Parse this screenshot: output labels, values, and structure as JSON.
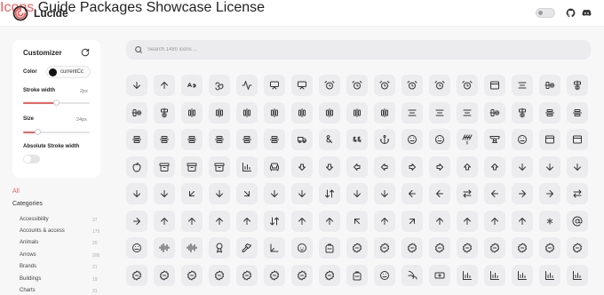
{
  "brand": {
    "name": "Lucide",
    "accent": "#f25f5c"
  },
  "nav": [
    {
      "label": "Icons",
      "active": true
    },
    {
      "label": "Guide",
      "active": false
    },
    {
      "label": "Packages",
      "active": false
    },
    {
      "label": "Showcase",
      "active": false
    },
    {
      "label": "License",
      "active": false
    }
  ],
  "header_icons": [
    "theme-toggle",
    "github-icon",
    "discord-icon"
  ],
  "customizer": {
    "title": "Customizer",
    "color_label": "Color",
    "color_value": "currentCc",
    "stroke_label": "Stroke width",
    "stroke_value": "2px",
    "stroke_level": 0.5,
    "size_label": "Size",
    "size_value": "24px",
    "size_level": 0.22,
    "absolute_label": "Absolute Stroke width",
    "absolute_on": false
  },
  "sidebar": {
    "all_label": "All",
    "categories_label": "Categories",
    "categories": [
      {
        "label": "Accessibility",
        "count": "27"
      },
      {
        "label": "Accounts & access",
        "count": "175"
      },
      {
        "label": "Animals",
        "count": "20"
      },
      {
        "label": "Arrows",
        "count": "200"
      },
      {
        "label": "Brands",
        "count": "21"
      },
      {
        "label": "Buildings",
        "count": "19"
      },
      {
        "label": "Charts",
        "count": "31"
      }
    ]
  },
  "search": {
    "placeholder": "Search 1480 icons ..."
  },
  "icons": [
    [
      "arrow-down-a-z",
      "arrow-up-a-z",
      "case-sensitive",
      "om",
      "activity",
      "air-vent",
      "airplay",
      "alarm-clock",
      "alarm-check",
      "alarm-minus",
      "alarm-off",
      "alarm-plus",
      "alarm-smoke",
      "album",
      "align-center",
      "align-center-horizontal",
      "align-center-vertical"
    ],
    [
      "align-end-horizontal",
      "align-end-vertical",
      "align-h-distribute-center",
      "align-h-distribute-end",
      "align-h-distribute-start",
      "align-h-justify-center",
      "align-h-justify-end",
      "align-h-justify-start",
      "align-h-space-around",
      "align-h-space-between",
      "align-justify",
      "align-left",
      "align-right",
      "align-start-horizontal",
      "align-start-vertical",
      "align-v-distribute-center",
      "align-v-distribute-end"
    ],
    [
      "align-v-distribute-start",
      "align-v-justify-center",
      "align-v-justify-end",
      "align-v-justify-start",
      "align-v-space-around",
      "align-v-space-between",
      "ambulance",
      "ampersand",
      "ampersands",
      "anchor",
      "angry",
      "annoyed",
      "antenna",
      "anvil",
      "aperture",
      "app-window",
      "app-window-mac"
    ],
    [
      "apple",
      "archive",
      "archive-restore",
      "archive-x",
      "area-chart",
      "armchair",
      "arrow-big-down",
      "arrow-big-down-dash",
      "arrow-big-left",
      "arrow-big-left-dash",
      "arrow-big-right",
      "arrow-big-right-dash",
      "arrow-big-up",
      "arrow-big-up-dash",
      "arrow-down",
      "arrow-down-0-1",
      "arrow-down-1-0"
    ],
    [
      "arrow-down-a-z",
      "arrow-down-from-line",
      "arrow-down-left",
      "arrow-down-narrow-wide",
      "arrow-down-right",
      "arrow-down-to-dot",
      "arrow-down-to-line",
      "arrow-down-up",
      "arrow-down-wide-narrow",
      "arrow-down-z-a",
      "arrow-left",
      "arrow-left-from-line",
      "arrow-left-right",
      "arrow-left-to-line",
      "arrow-right",
      "arrow-right-from-line",
      "arrow-right-left"
    ],
    [
      "arrow-right-to-line",
      "arrow-up",
      "arrow-up-0-1",
      "arrow-up-1-0",
      "arrow-up-a-z",
      "arrow-up-down",
      "arrow-up-from-dot",
      "arrow-up-from-line",
      "arrow-up-left",
      "arrow-up-narrow-wide",
      "arrow-up-right",
      "arrow-up-to-line",
      "arrow-up-wide-narrow",
      "arrow-up-z-a",
      "arrows-up-from-line",
      "asterisk",
      "at-sign"
    ],
    [
      "atom",
      "audio-lines",
      "audio-waveform",
      "award",
      "axe",
      "axis-3d",
      "baby",
      "backpack",
      "badge",
      "badge-alert",
      "badge-cent",
      "badge-check",
      "badge-dollar-sign",
      "badge-euro",
      "badge-help",
      "badge-indian-rupee",
      "badge-info"
    ],
    [
      "badge-japanese-yen",
      "badge-minus",
      "badge-percent",
      "badge-plus",
      "badge-pound-sterling",
      "badge-russian-ruble",
      "badge-swiss-franc",
      "badge-x",
      "baggage-claim",
      "ban",
      "banana",
      "banknote",
      "bar-chart",
      "bar-chart-2",
      "bar-chart-3",
      "bar-chart-4",
      "bar-chart-big"
    ]
  ]
}
